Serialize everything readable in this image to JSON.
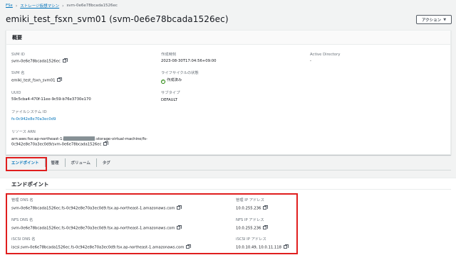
{
  "breadcrumb": {
    "root": "FSx",
    "parent": "ストレージ仮想マシン",
    "current": "svm-0e6e78bcada1526ec"
  },
  "page_title": "emiki_test_fsxn_svm01 (svm-0e6e78bcada1526ec)",
  "actions_label": "アクション",
  "summary": {
    "heading": "概要",
    "svm_id_label": "SVM ID",
    "svm_id": "svm-0e6e78bcada1526ec",
    "svm_name_label": "SVM 名",
    "svm_name": "emiki_test_fsxn_svm01",
    "uuid_label": "UUID",
    "uuid": "59c5cba4-470f-11ee-9c59-b76e3730e170",
    "fs_id_label": "ファイルシステム ID",
    "fs_id": "fs-0c942e8e70a3ec0d9",
    "arn_label": "リソース ARN",
    "arn_line1_prefix": "arn:aws:fsx:ap-northeast-1:",
    "arn_line1_suffix": ":storage-virtual-machine/fs-",
    "arn_line2": "0c942e8e70a3ec0d9/svm-0e6e78bcada1526ec",
    "created_label": "作成時刻",
    "created": "2023-08-30T17:04:56+09:00",
    "lifecycle_label": "ライフサイクルの状態",
    "lifecycle": "作成済み",
    "subtype_label": "サブタイプ",
    "subtype": "DEFAULT",
    "ad_label": "Active Directory",
    "ad": "-"
  },
  "tabs": [
    "エンドポイント",
    "管理",
    "ボリューム",
    "タグ"
  ],
  "endpoints": {
    "heading": "エンドポイント",
    "mgmt_dns_label": "管理 DNS 名",
    "mgmt_dns": "svm-0e6e78bcada1526ec.fs-0c942e8e70a3ec0d9.fsx.ap-northeast-1.amazonaws.com",
    "nfs_dns_label": "NFS DNS 名",
    "nfs_dns": "svm-0e6e78bcada1526ec.fs-0c942e8e70a3ec0d9.fsx.ap-northeast-1.amazonaws.com",
    "iscsi_dns_label": "iSCSI DNS 名",
    "iscsi_dns": "iscsi.svm-0e6e78bcada1526ec.fs-0c942e8e70a3ec0d9.fsx.ap-northeast-1.amazonaws.com",
    "mgmt_ip_label": "管理 IP アドレス",
    "mgmt_ip": "10.0.255.236",
    "nfs_ip_label": "NFS IP アドレス",
    "nfs_ip": "10.0.255.236",
    "iscsi_ip_label": "iSCSI IP アドレス",
    "iscsi_ip": "10.0.10.49, 10.0.11.118"
  },
  "colors": {
    "link": "#0073bb",
    "highlight": "#e01e1e",
    "success": "#1d8102"
  }
}
